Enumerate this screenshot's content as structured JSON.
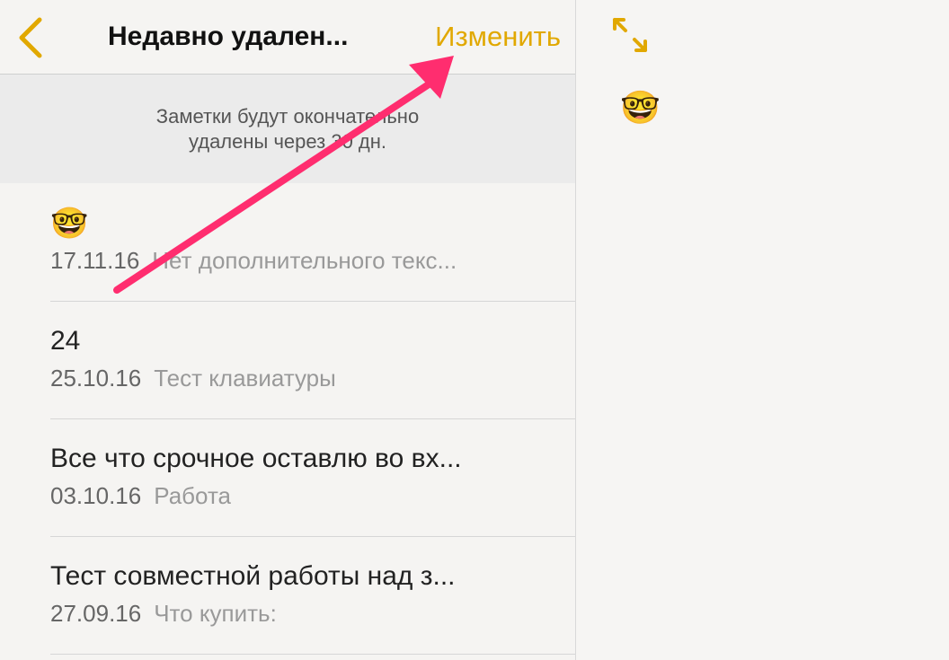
{
  "header": {
    "title": "Недавно удален...",
    "edit_label": "Изменить"
  },
  "notice": {
    "line1": "Заметки будут окончательно",
    "line2": "удалены через 30 дн."
  },
  "notes": [
    {
      "title": "🤓",
      "date": "17.11.16",
      "preview": "Нет дополнительного текс..."
    },
    {
      "title": "24",
      "date": "25.10.16",
      "preview": "Тест клавиатуры"
    },
    {
      "title": "Все что срочное оставлю во вх...",
      "date": "03.10.16",
      "preview": "Работа"
    },
    {
      "title": "Тест совместной работы над з...",
      "date": "27.09.16",
      "preview": "Что купить:"
    }
  ],
  "detail": {
    "content": "🤓"
  },
  "icons": {
    "back": "chevron-left-icon",
    "expand": "expand-arrows-icon"
  },
  "colors": {
    "accent": "#e1a800",
    "annotation_arrow": "#ff2d6f"
  }
}
